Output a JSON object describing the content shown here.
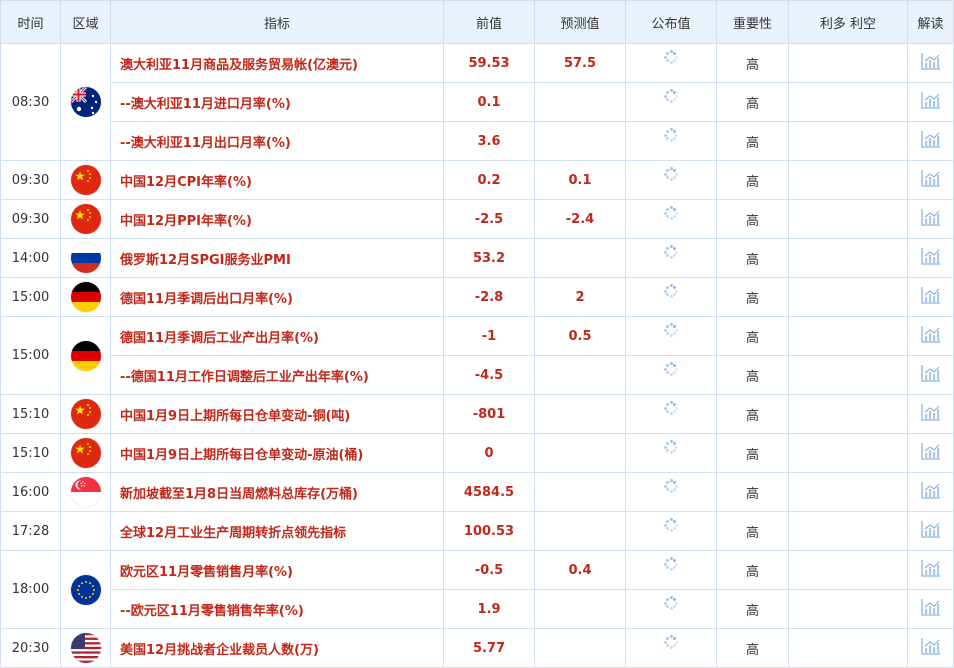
{
  "header": {
    "time": "时间",
    "region": "区域",
    "indicator": "指标",
    "previous": "前值",
    "forecast": "预测值",
    "actual": "公布值",
    "importance": "重要性",
    "bull_bear": "利多 利空",
    "analysis": "解读"
  },
  "rows": [
    {
      "time": "08:30",
      "flag": "australia-flag",
      "indicator": "澳大利亚11月商品及服务贸易帐(亿澳元)",
      "previous": "59.53",
      "forecast": "57.5",
      "importance": "高"
    },
    {
      "time": "",
      "flag": "",
      "indicator": "--澳大利亚11月进口月率(%)",
      "previous": "0.1",
      "forecast": "",
      "importance": "高"
    },
    {
      "time": "",
      "flag": "",
      "indicator": "--澳大利亚11月出口月率(%)",
      "previous": "3.6",
      "forecast": "",
      "importance": "高"
    },
    {
      "time": "09:30",
      "flag": "china-flag",
      "indicator": "中国12月CPI年率(%)",
      "previous": "0.2",
      "forecast": "0.1",
      "importance": "高"
    },
    {
      "time": "09:30",
      "flag": "china-flag",
      "indicator": "中国12月PPI年率(%)",
      "previous": "-2.5",
      "forecast": "-2.4",
      "importance": "高"
    },
    {
      "time": "14:00",
      "flag": "russia-flag",
      "indicator": "俄罗斯12月SPGI服务业PMI",
      "previous": "53.2",
      "forecast": "",
      "importance": "高"
    },
    {
      "time": "15:00",
      "flag": "germany-flag",
      "indicator": "德国11月季调后出口月率(%)",
      "previous": "-2.8",
      "forecast": "2",
      "importance": "高"
    },
    {
      "time": "15:00",
      "flag": "germany-flag",
      "indicator": "德国11月季调后工业产出月率(%)",
      "previous": "-1",
      "forecast": "0.5",
      "importance": "高"
    },
    {
      "time": "",
      "flag": "",
      "indicator": "--德国11月工作日调整后工业产出年率(%)",
      "previous": "-4.5",
      "forecast": "",
      "importance": "高"
    },
    {
      "time": "15:10",
      "flag": "china-flag",
      "indicator": "中国1月9日上期所每日仓单变动-铜(吨)",
      "previous": "-801",
      "forecast": "",
      "importance": "高"
    },
    {
      "time": "15:10",
      "flag": "china-flag",
      "indicator": "中国1月9日上期所每日仓单变动-原油(桶)",
      "previous": "0",
      "forecast": "",
      "importance": "高"
    },
    {
      "time": "16:00",
      "flag": "singapore-flag",
      "indicator": "新加坡截至1月8日当周燃料总库存(万桶)",
      "previous": "4584.5",
      "forecast": "",
      "importance": "高"
    },
    {
      "time": "17:28",
      "flag": "",
      "indicator": "全球12月工业生产周期转折点领先指标",
      "previous": "100.53",
      "forecast": "",
      "importance": "高"
    },
    {
      "time": "18:00",
      "flag": "eu-flag",
      "indicator": "欧元区11月零售销售月率(%)",
      "previous": "-0.5",
      "forecast": "0.4",
      "importance": "高"
    },
    {
      "time": "",
      "flag": "",
      "indicator": "--欧元区11月零售销售年率(%)",
      "previous": "1.9",
      "forecast": "",
      "importance": "高"
    },
    {
      "time": "20:30",
      "flag": "usa-flag",
      "indicator": "美国12月挑战者企业裁员人数(万)",
      "previous": "5.77",
      "forecast": "",
      "importance": "高"
    }
  ]
}
